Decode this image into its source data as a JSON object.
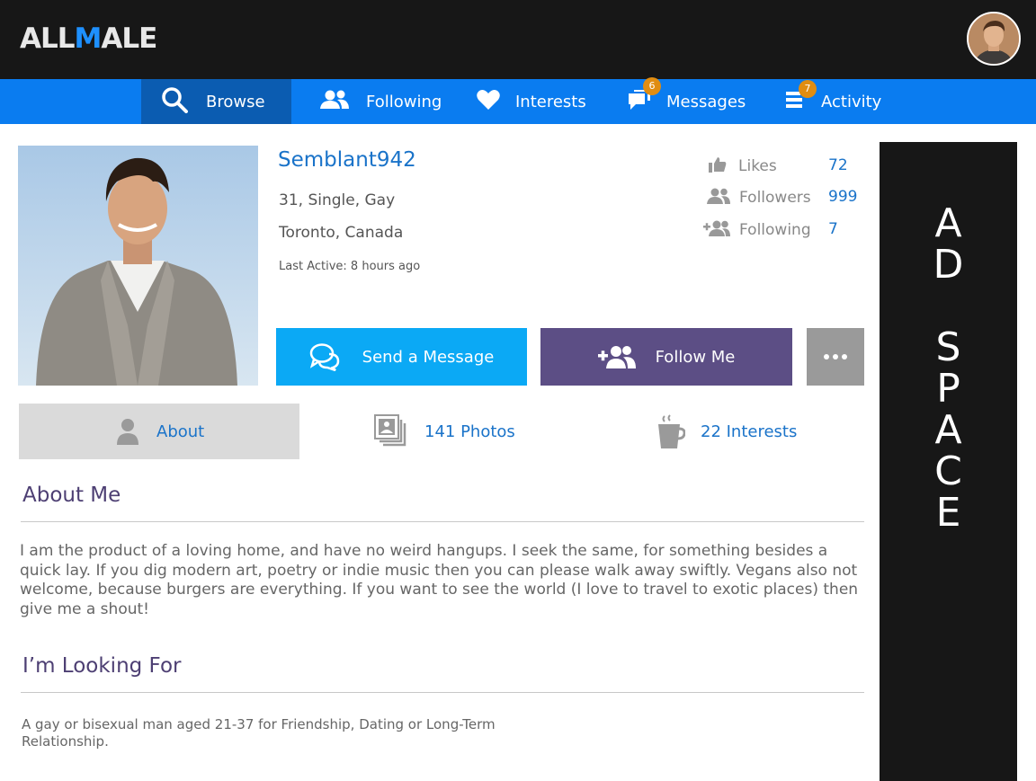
{
  "brand": {
    "logo_part1": "ALL",
    "logo_part2": "M",
    "logo_part3": "ALE"
  },
  "nav": {
    "browse": "Browse",
    "following": "Following",
    "interests": "Interests",
    "messages": "Messages",
    "messages_badge": "6",
    "activity": "Activity",
    "activity_badge": "7"
  },
  "profile": {
    "username": "Semblant942",
    "details": "31, Single, Gay",
    "location": "Toronto, Canada",
    "last_active": "Last Active: 8 hours ago"
  },
  "stats": {
    "likes_label": "Likes",
    "likes_value": "72",
    "followers_label": "Followers",
    "followers_value": "999",
    "following_label": "Following",
    "following_value": "7"
  },
  "actions": {
    "send_message": "Send a Message",
    "follow_me": "Follow Me"
  },
  "tabs": {
    "about": "About",
    "photos": "141 Photos",
    "interests": "22 Interests"
  },
  "about": {
    "title": "About Me",
    "text": "I am the product of a loving home, and have no weird hangups. I seek the same, for something besides a quick lay. If you dig modern art, poetry or indie music then you can please walk away swiftly. Vegans also not welcome, because burgers are everything. If you want to see the world (I love to travel to exotic places) then give me a shout!"
  },
  "looking_for": {
    "title": "I’m Looking For",
    "text": "A gay or bisexual man aged 21-37 for Friendship, Dating or Long-Term Relationship."
  },
  "ad": {
    "letters_1": [
      "A",
      "D"
    ],
    "letters_2": [
      "S",
      "P",
      "A",
      "C",
      "E"
    ]
  },
  "colors": {
    "nav": "#0a7cf0",
    "nav_active": "#0b5cb1",
    "message_btn": "#0ba9f5",
    "follow_btn": "#5c4e85",
    "badge": "#e08d12"
  }
}
